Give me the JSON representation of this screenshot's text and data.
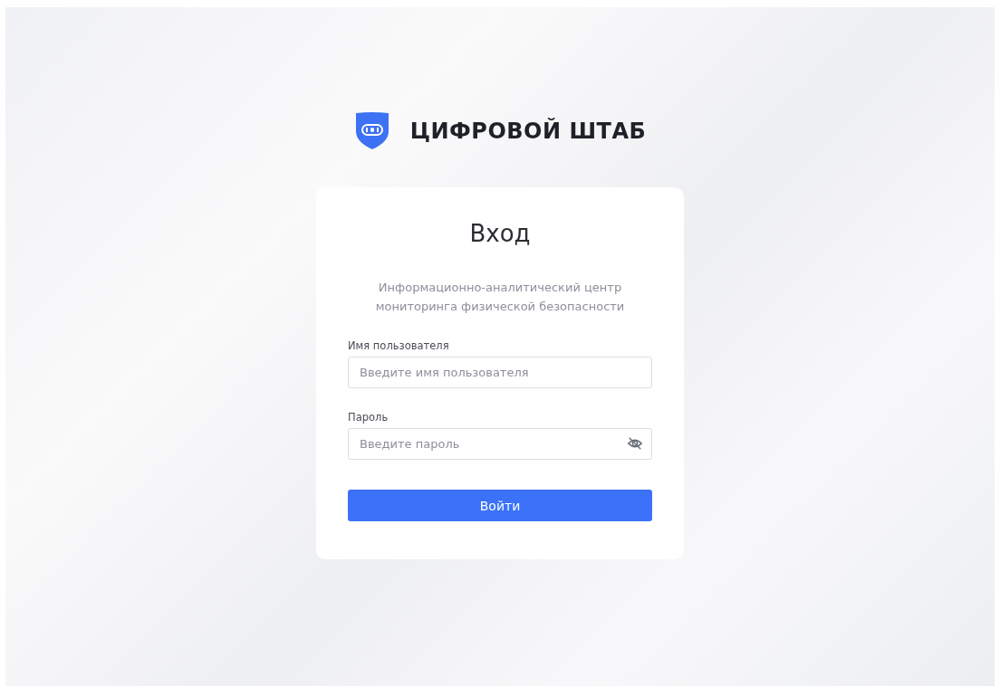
{
  "brand": {
    "name": "ЦИФРОВОЙ ШТАБ"
  },
  "login": {
    "title": "Вход",
    "subtitle": "Информационно-аналитический центр мониторинга физической безопасности",
    "fields": [
      {
        "kind": "text",
        "label": "Имя пользователя",
        "placeholder": "Введите имя пользователя"
      },
      {
        "kind": "password",
        "label": "Пароль",
        "placeholder": "Введите пароль"
      }
    ],
    "submit": "Войти"
  }
}
